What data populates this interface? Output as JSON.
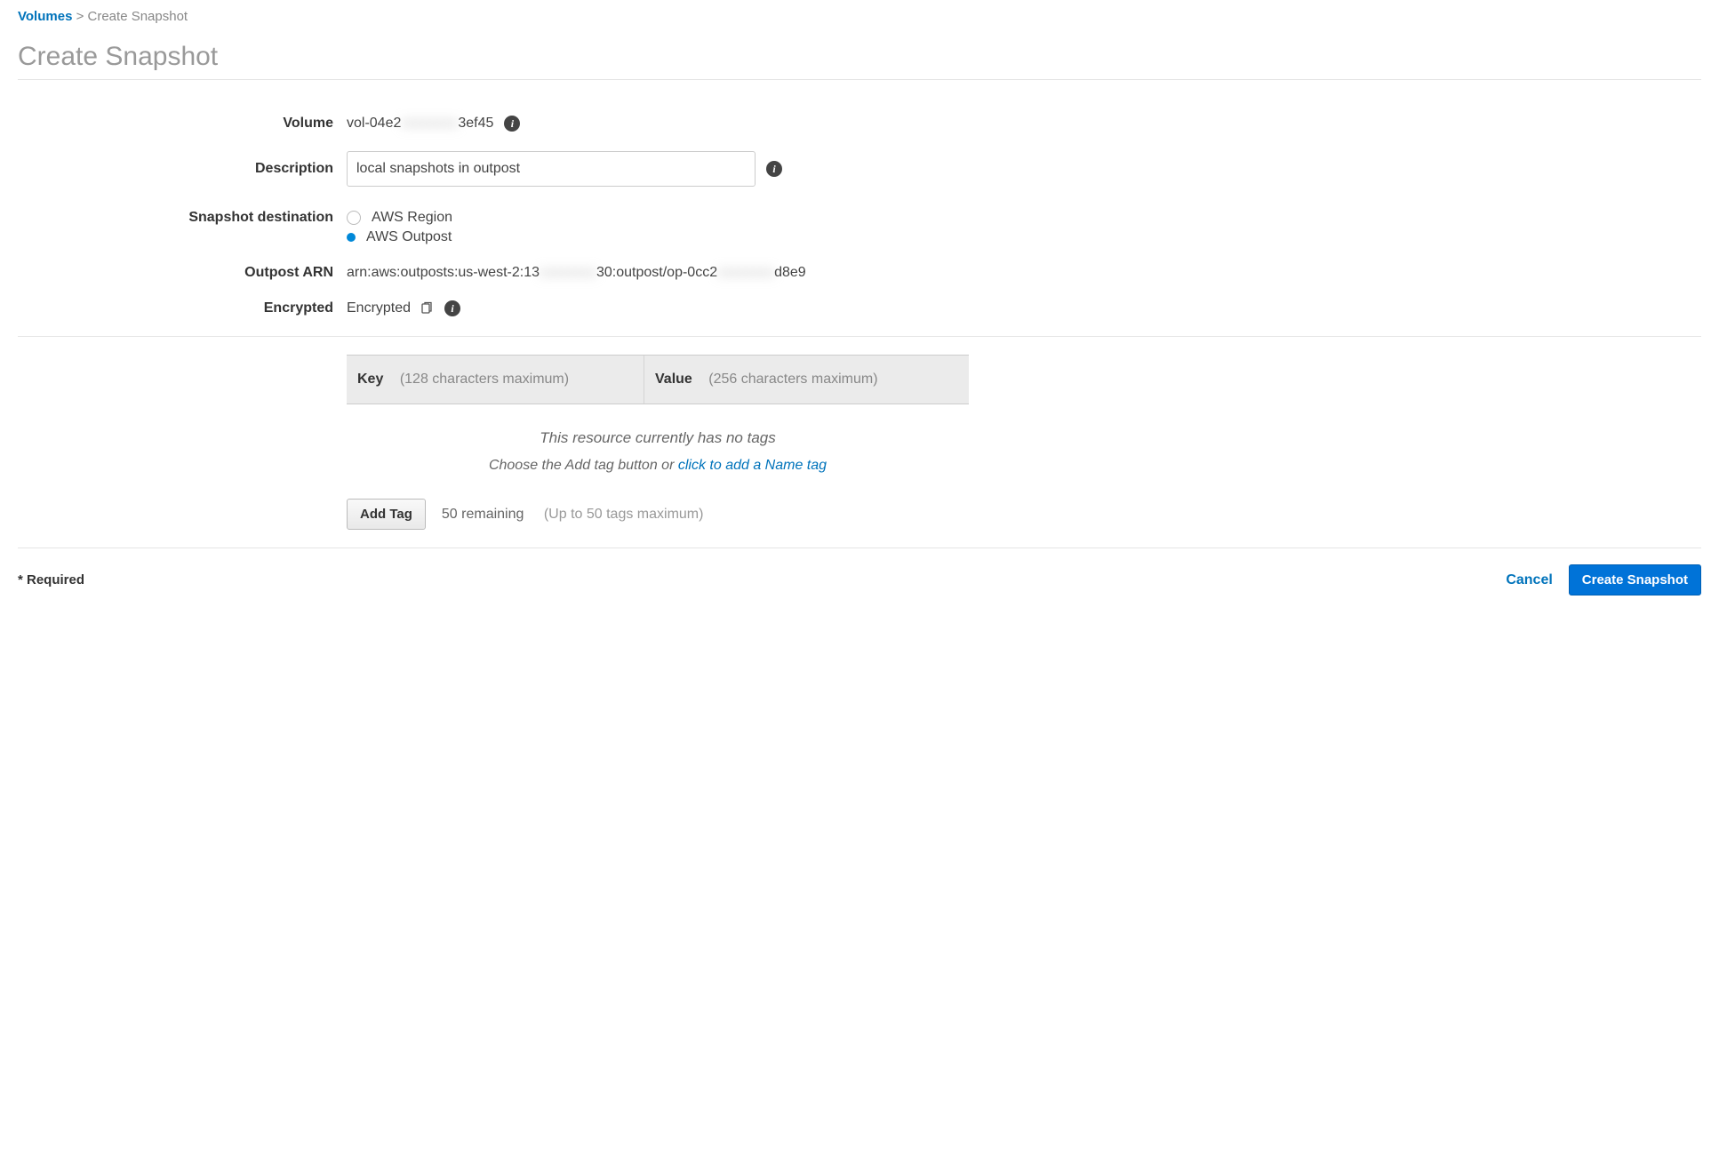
{
  "breadcrumb": {
    "parent": "Volumes",
    "separator": ">",
    "current": "Create Snapshot"
  },
  "page_title": "Create Snapshot",
  "form": {
    "volume": {
      "label": "Volume",
      "value_prefix": "vol-04e2",
      "value_blur": "xxxxxxxx",
      "value_suffix": "3ef45"
    },
    "description": {
      "label": "Description",
      "value": "local snapshots in outpost"
    },
    "snapshot_destination": {
      "label": "Snapshot destination",
      "option_region": "AWS Region",
      "option_outpost": "AWS Outpost"
    },
    "outpost_arn": {
      "label": "Outpost ARN",
      "value_prefix": "arn:aws:outposts:us-west-2:13",
      "value_blur1": "xxxxxxxx",
      "value_mid": "30:outpost/op-0cc2",
      "value_blur2": "xxxxxxxx",
      "value_suffix": "d8e9"
    },
    "encrypted": {
      "label": "Encrypted",
      "value": "Encrypted"
    }
  },
  "tags": {
    "key_header": "Key",
    "key_hint": "(128 characters maximum)",
    "value_header": "Value",
    "value_hint": "(256 characters maximum)",
    "empty_text": "This resource currently has no tags",
    "prompt_prefix": "Choose the Add tag button or ",
    "prompt_link": "click to add a Name tag",
    "add_tag_button": "Add Tag",
    "remaining": "50 remaining",
    "max_hint": "(Up to 50 tags maximum)"
  },
  "footer": {
    "required": "* Required",
    "cancel": "Cancel",
    "submit": "Create Snapshot"
  }
}
